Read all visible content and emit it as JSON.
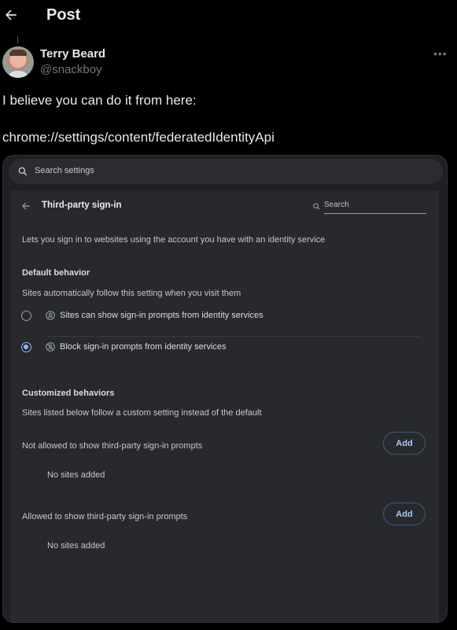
{
  "header": {
    "title": "Post",
    "back_icon": "arrow-left-icon"
  },
  "post": {
    "author": {
      "name": "Terry Beard",
      "handle": "@snackboy",
      "avatar_icon": "avatar-photo"
    },
    "more_icon": "more-horizontal-icon",
    "more_label": "•••",
    "text_lines": [
      "I believe you can do it from here:",
      "chrome://settings/content/federatedIdentityApi"
    ]
  },
  "screenshot": {
    "search_settings_placeholder": "Search settings",
    "page": {
      "title": "Third-party sign-in",
      "search_placeholder": "Search",
      "description": "Lets you sign in to websites using the account you have with an identity service",
      "default_behavior": {
        "heading": "Default behavior",
        "subtitle": "Sites automatically follow this setting when you visit them",
        "options": [
          {
            "label": "Sites can show sign-in prompts from identity services",
            "icon": "account-circle-icon",
            "checked": false
          },
          {
            "label": "Block sign-in prompts from identity services",
            "icon": "account-blocked-icon",
            "checked": true
          }
        ]
      },
      "customized_behaviors": {
        "heading": "Customized behaviors",
        "subtitle": "Sites listed below follow a custom setting instead of the default",
        "lists": [
          {
            "label": "Not allowed to show third-party sign-in prompts",
            "button": "Add",
            "empty": "No sites added"
          },
          {
            "label": "Allowed to show third-party sign-in prompts",
            "button": "Add",
            "empty": "No sites added"
          }
        ]
      }
    },
    "colors": {
      "accent": "#8ab4f8",
      "card_bg": "#28292d",
      "outer_bg": "#1f2023",
      "button_border": "#2f5f80"
    }
  }
}
